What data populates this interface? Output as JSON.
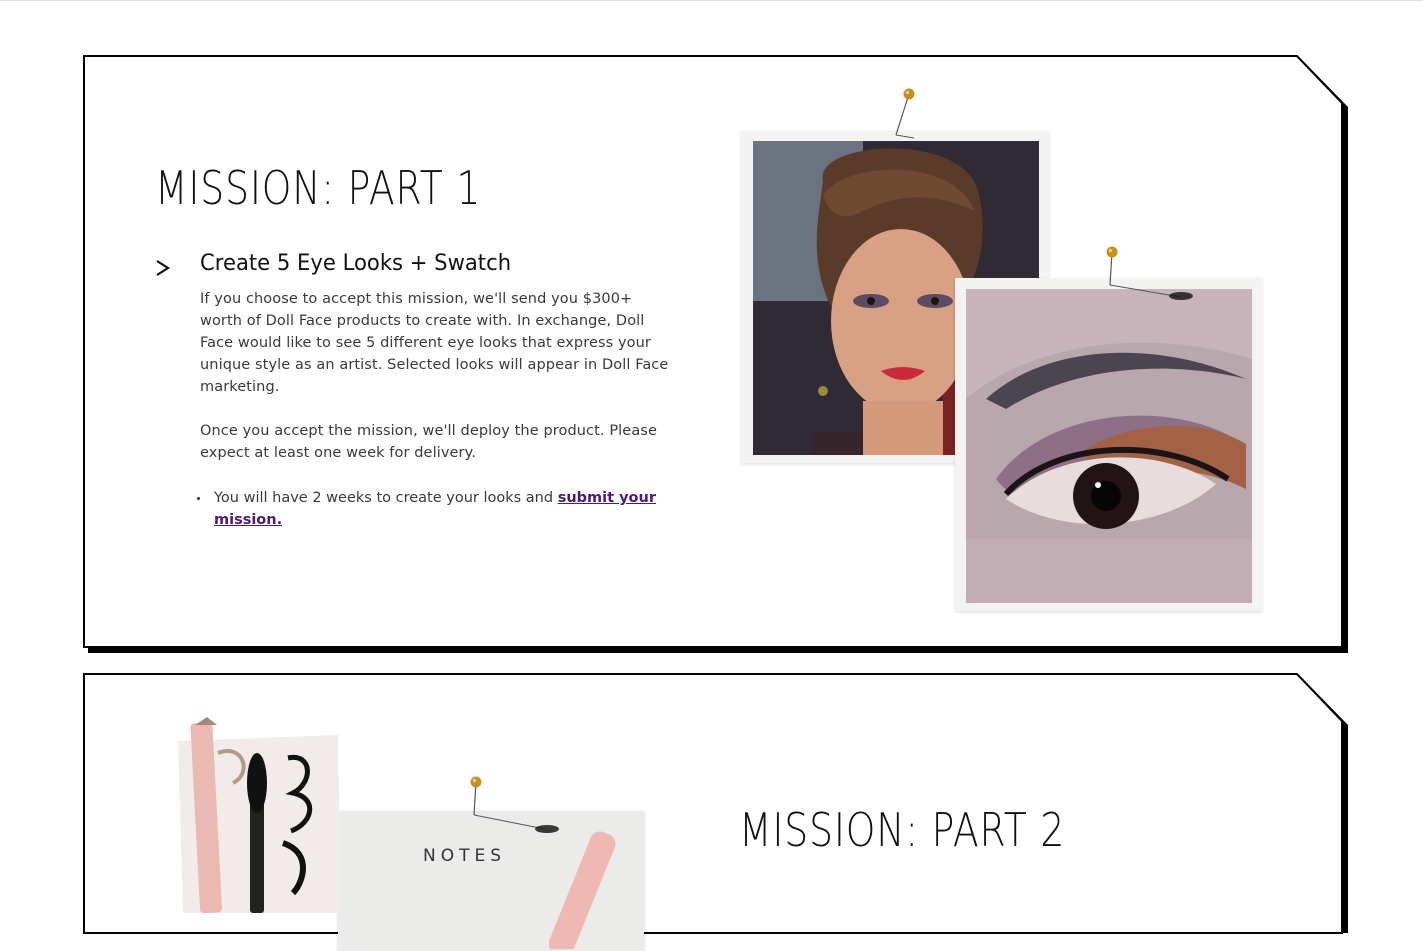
{
  "mission1": {
    "title": "MISSION: PART 1",
    "task_title": "Create 5 Eye Looks + Swatch",
    "paragraph1": "If you choose to accept this mission, we'll send you $300+ worth of Doll Face products to create with. In exchange, Doll Face would like to see 5 different eye looks that express your unique style as an artist. Selected looks will appear in Doll Face marketing.",
    "paragraph2": "Once you accept the mission, we'll deploy the product. Please expect at least one week for delivery.",
    "bullet_text": "You will have 2 weeks to create your looks and ",
    "bullet_link": "submit your mission."
  },
  "mission2": {
    "title": "MISSION: PART 2",
    "notes_label": "NOTES"
  },
  "colors": {
    "link": "#4b1a7a",
    "frame": "#000000",
    "pin_gold": "#c8911e"
  },
  "icons": [
    "chevron-right-icon",
    "pushpin-icon"
  ]
}
